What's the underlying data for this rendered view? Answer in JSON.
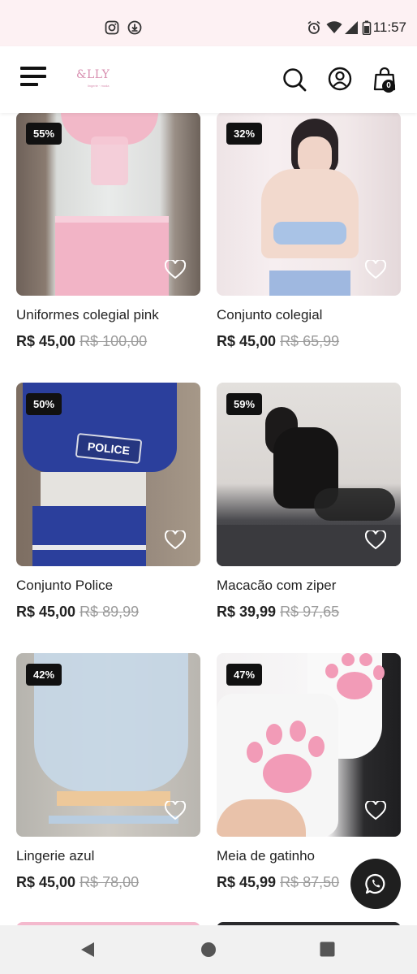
{
  "status_bar": {
    "time": "11:57",
    "left_icons": [
      "instagram-icon",
      "download-icon"
    ],
    "right_icons": [
      "alarm-icon",
      "wifi-icon",
      "signal-icon",
      "battery-icon"
    ]
  },
  "header": {
    "logo_text": "&LLY",
    "logo_tagline": "lingerie · moda",
    "cart_count": "0",
    "icons": [
      "menu-icon",
      "search-icon",
      "account-icon",
      "cart-icon"
    ]
  },
  "products": [
    {
      "name": "Uniformes colegial pink",
      "price": "R$ 45,00",
      "old_price": "R$ 100,00",
      "discount": "55%"
    },
    {
      "name": "Conjunto colegial",
      "price": "R$ 45,00",
      "old_price": "R$ 65,99",
      "discount": "32%"
    },
    {
      "name": "Conjunto Police",
      "price": "R$ 45,00",
      "old_price": "R$ 89,99",
      "discount": "50%"
    },
    {
      "name": "Macacão com ziper",
      "price": "R$ 39,99",
      "old_price": "R$ 97,65",
      "discount": "59%"
    },
    {
      "name": "Lingerie azul",
      "price": "R$ 45,00",
      "old_price": "R$ 78,00",
      "discount": "42%"
    },
    {
      "name": "Meia de gatinho",
      "price": "R$ 45,99",
      "old_price": "R$ 87,50",
      "discount": "47%"
    }
  ],
  "police_patch_text": "POLICE",
  "whatsapp": {
    "icon": "whatsapp-icon"
  },
  "nav": {
    "icons": [
      "back-icon",
      "home-icon",
      "recents-icon"
    ]
  },
  "colors": {
    "brand_pink": "#d88fb0",
    "badge": "#111111",
    "status_bar": "#fdf1f3"
  }
}
